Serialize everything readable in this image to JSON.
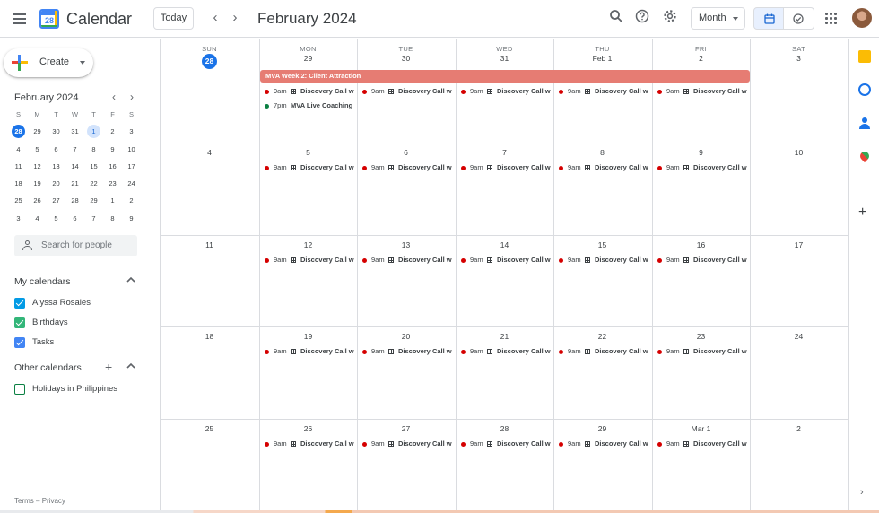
{
  "app": {
    "title": "Calendar",
    "logo_number": "28"
  },
  "header": {
    "today_label": "Today",
    "prev_symbol": "‹",
    "next_symbol": "›",
    "period_title": "February 2024",
    "view_label": "Month",
    "icons": [
      "menu-icon",
      "search-icon",
      "help-icon",
      "settings-icon",
      "calendar-view-icon",
      "tasks-view-icon",
      "apps-icon"
    ]
  },
  "sidebar": {
    "create_label": "Create",
    "mini_calendar": {
      "title": "February 2024",
      "weekdays": [
        "S",
        "M",
        "T",
        "W",
        "T",
        "F",
        "S"
      ],
      "weeks": [
        [
          "28",
          "29",
          "30",
          "31",
          "1",
          "2",
          "3"
        ],
        [
          "4",
          "5",
          "6",
          "7",
          "8",
          "9",
          "10"
        ],
        [
          "11",
          "12",
          "13",
          "14",
          "15",
          "16",
          "17"
        ],
        [
          "18",
          "19",
          "20",
          "21",
          "22",
          "23",
          "24"
        ],
        [
          "25",
          "26",
          "27",
          "28",
          "29",
          "1",
          "2"
        ],
        [
          "3",
          "4",
          "5",
          "6",
          "7",
          "8",
          "9"
        ]
      ]
    },
    "search_people_placeholder": "Search for people",
    "my_calendars": {
      "title": "My calendars",
      "items": [
        {
          "label": "Alyssa Rosales",
          "color": "#039be5",
          "checked": true
        },
        {
          "label": "Birthdays",
          "color": "#33b679",
          "checked": true
        },
        {
          "label": "Tasks",
          "color": "#4285f4",
          "checked": true
        }
      ]
    },
    "other_calendars": {
      "title": "Other calendars",
      "items": [
        {
          "label": "Holidays in Philippines",
          "color": "#0b8043",
          "checked": false
        }
      ]
    },
    "footer": {
      "terms": "Terms",
      "separator": "–",
      "privacy": "Privacy"
    }
  },
  "month_grid": {
    "weekday_headers": [
      "SUN",
      "MON",
      "TUE",
      "WED",
      "THU",
      "FRI",
      "SAT"
    ],
    "weeks": [
      [
        "28",
        "29",
        "30",
        "31",
        "Feb 1",
        "2",
        "3"
      ],
      [
        "4",
        "5",
        "6",
        "7",
        "8",
        "9",
        "10"
      ],
      [
        "11",
        "12",
        "13",
        "14",
        "15",
        "16",
        "17"
      ],
      [
        "18",
        "19",
        "20",
        "21",
        "22",
        "23",
        "24"
      ],
      [
        "25",
        "26",
        "27",
        "28",
        "29",
        "Mar 1",
        "2"
      ]
    ],
    "allday_event": {
      "title": "MVA Week 2: Client Attraction",
      "color": "#e67c73"
    },
    "recurring_event": {
      "time": "9am",
      "title": "Discovery Call w",
      "color": "#d50000"
    },
    "extra_event": {
      "time": "7pm",
      "title": "MVA Live Coaching",
      "color": "#0b8043"
    }
  },
  "colors": {
    "accent": "#1a73e8",
    "today_bg": "#1a73e8",
    "selected_day_bg": "#d2e3fc",
    "border": "#dadce0"
  }
}
